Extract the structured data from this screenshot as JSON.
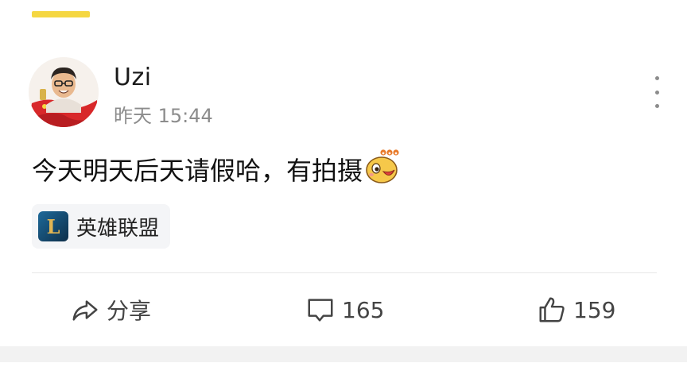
{
  "post": {
    "author": "Uzi",
    "timestamp": "昨天 15:44",
    "content": "今天明天后天请假哈，有拍摄",
    "emoji": "666-emoji-icon",
    "topic_tag": "英雄联盟",
    "topic_icon_letter": "L"
  },
  "actions": {
    "share_label": "分享",
    "comment_count": "165",
    "like_count": "159"
  },
  "colors": {
    "accent_yellow": "#f5d742",
    "muted_text": "#8c8c8c",
    "divider": "#e8e8e8",
    "tag_bg": "#f4f5f7",
    "lol_icon_gold": "#e2b552",
    "lol_icon_blue": "#1e6a9a"
  }
}
